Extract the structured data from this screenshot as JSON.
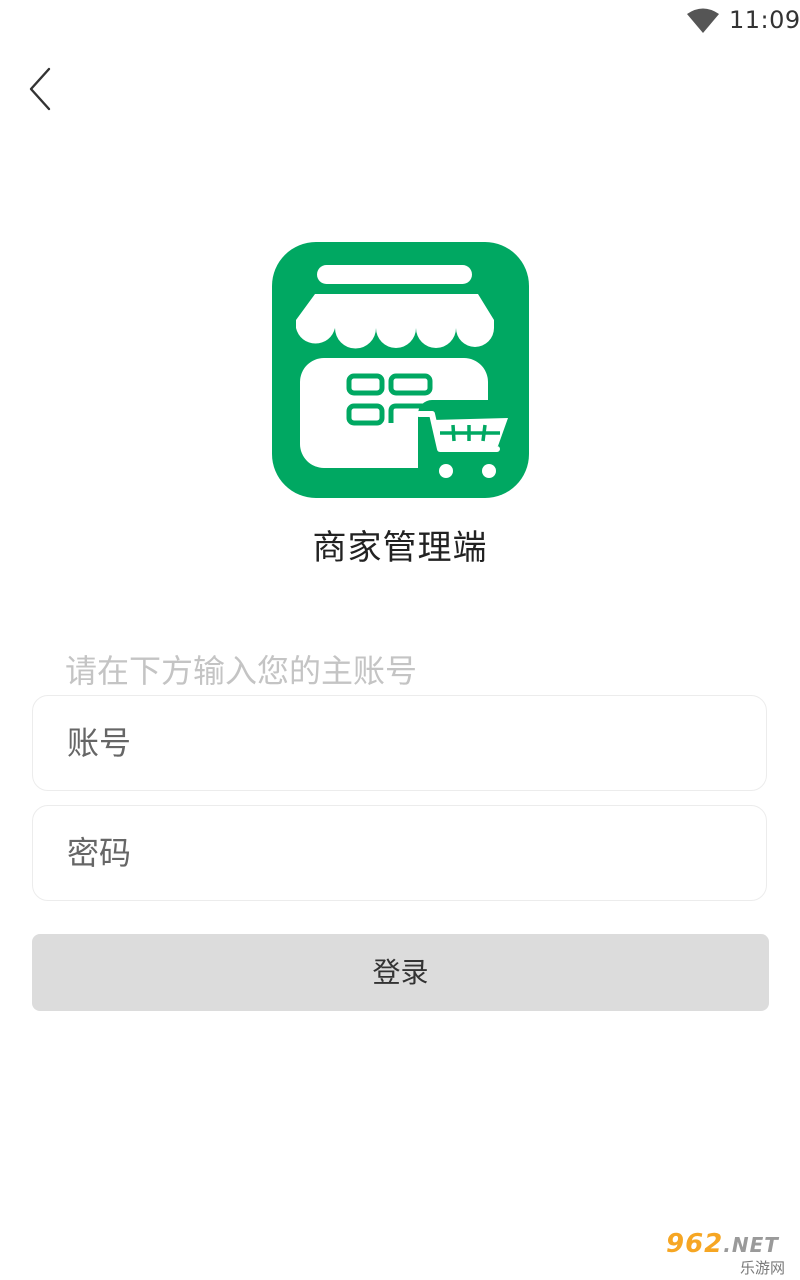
{
  "status_bar": {
    "time": "11:09",
    "wifi_icon": "wifi-icon"
  },
  "nav": {
    "back_icon": "chevron-left-icon"
  },
  "app": {
    "logo_icon": "store-cart-icon",
    "name": "商家管理端",
    "brand_color": "#00a862"
  },
  "login_form": {
    "instruction": "请在下方输入您的主账号",
    "account_placeholder": "账号",
    "account_value": "",
    "password_placeholder": "密码",
    "password_value": "",
    "login_label": "登录"
  },
  "watermark": {
    "brand": "962",
    "suffix": ".NET",
    "subtitle": "乐游网"
  }
}
